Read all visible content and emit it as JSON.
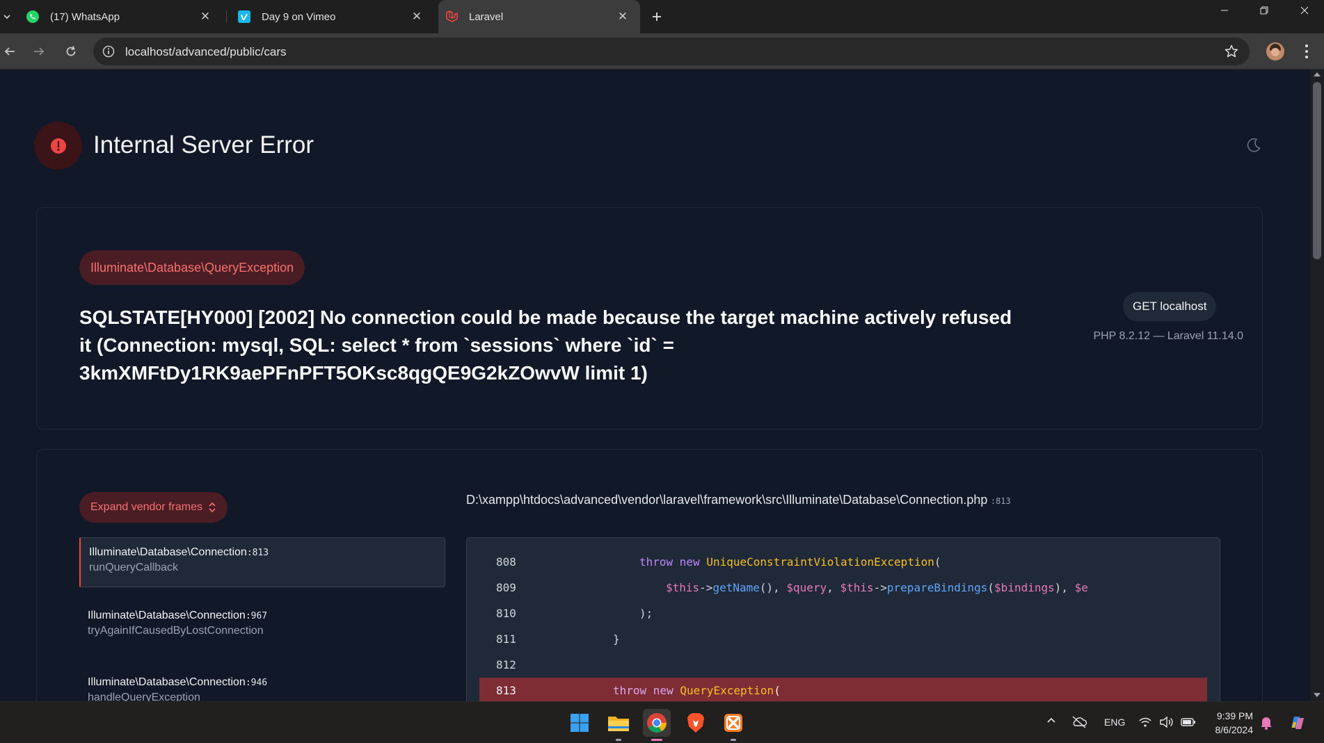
{
  "tabs": [
    {
      "label": "(17) WhatsApp",
      "icon": "whatsapp-icon"
    },
    {
      "label": "Day 9 on Vimeo",
      "icon": "vimeo-icon"
    },
    {
      "label": "Laravel",
      "icon": "laravel-icon"
    }
  ],
  "address_bar": {
    "url": "localhost/advanced/public/cars"
  },
  "error_page": {
    "title": "Internal Server Error",
    "exception_class": "Illuminate\\Database\\QueryException",
    "message": "SQLSTATE[HY000] [2002] No connection could be made because the target machine actively refused it (Connection: mysql, SQL: select * from `sessions` where `id` = 3kmXMFtDy1RK9aePFnPFT5OKsc8qgQE9G2kZOwvW limit 1)",
    "request_badge": "GET localhost",
    "versions": "PHP 8.2.12 — Laravel 11.14.0",
    "expand_vendor_label": "Expand vendor frames",
    "frames": [
      {
        "class": "Illuminate\\Database\\Connection",
        "line": ":813",
        "method": "runQueryCallback"
      },
      {
        "class": "Illuminate\\Database\\Connection",
        "line": ":967",
        "method": "tryAgainIfCausedByLostConnection"
      },
      {
        "class": "Illuminate\\Database\\Connection",
        "line": ":946",
        "method": "handleQueryException"
      }
    ],
    "file_path": "D:\\xampp\\htdocs\\advanced\\vendor\\laravel\\framework\\src\\Illuminate\\Database\\Connection.php",
    "file_line": ":813",
    "code_lines": [
      {
        "num": "808",
        "text": "throw new UniqueConstraintViolationException("
      },
      {
        "num": "809",
        "text": "$this->getName(), $query, $this->prepareBindings($bindings), $e"
      },
      {
        "num": "810",
        "text": ");"
      },
      {
        "num": "811",
        "text": "}"
      },
      {
        "num": "812",
        "text": ""
      },
      {
        "num": "813",
        "text": "throw new QueryException("
      }
    ]
  },
  "taskbar": {
    "language": "ENG",
    "time": "9:39 PM",
    "date": "8/6/2024"
  },
  "colors": {
    "accent_red": "#ef4444",
    "badge_bg": "#4a1d24",
    "highlight_line": "#7f2d35",
    "code_keyword": "#c084fc",
    "code_class": "#fbbf24",
    "code_var": "#e879b9",
    "code_method": "#60a5fa"
  }
}
